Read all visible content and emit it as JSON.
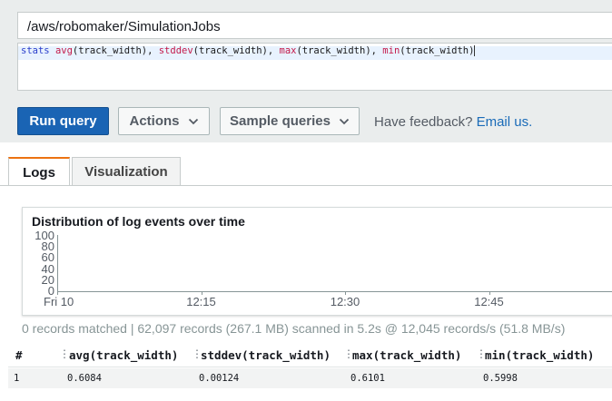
{
  "log_group": {
    "value": "/aws/robomaker/SimulationJobs"
  },
  "query": {
    "tokens": [
      {
        "t": "stats",
        "k": "kw"
      },
      {
        "t": " ",
        "k": "txt"
      },
      {
        "t": "avg",
        "k": "fn"
      },
      {
        "t": "(track_width), ",
        "k": "txt"
      },
      {
        "t": "stddev",
        "k": "fn"
      },
      {
        "t": "(track_width), ",
        "k": "txt"
      },
      {
        "t": "max",
        "k": "fn"
      },
      {
        "t": "(track_width), ",
        "k": "txt"
      },
      {
        "t": "min",
        "k": "fn"
      },
      {
        "t": "(track_width)",
        "k": "txt"
      }
    ]
  },
  "toolbar": {
    "run_label": "Run query",
    "actions_label": "Actions",
    "sample_label": "Sample queries",
    "feedback_text": "Have feedback?",
    "feedback_link": "Email us."
  },
  "tabs": {
    "logs": "Logs",
    "visualization": "Visualization"
  },
  "chart_data": {
    "type": "bar",
    "title": "Distribution of log events over time",
    "y_ticks": [
      "100",
      "80",
      "60",
      "40",
      "20",
      "0"
    ],
    "ylim": [
      0,
      100
    ],
    "x_ticks": [
      "Fri 10",
      "12:15",
      "12:30",
      "12:45"
    ],
    "categories": [],
    "values": [],
    "grid": false
  },
  "summary": "0 records matched | 62,097 records (267.1 MB) scanned in 5.2s @ 12,045 records/s (51.8 MB/s)",
  "results": {
    "columns": [
      "#",
      "avg(track_width)",
      "stddev(track_width)",
      "max(track_width)",
      "min(track_width)"
    ],
    "rows": [
      [
        "1",
        "0.6084",
        "0.00124",
        "0.6101",
        "0.5998"
      ]
    ]
  },
  "colors": {
    "primary": "#1a64b4",
    "active_tab": "#ec7211",
    "link": "#1a6bb8"
  }
}
